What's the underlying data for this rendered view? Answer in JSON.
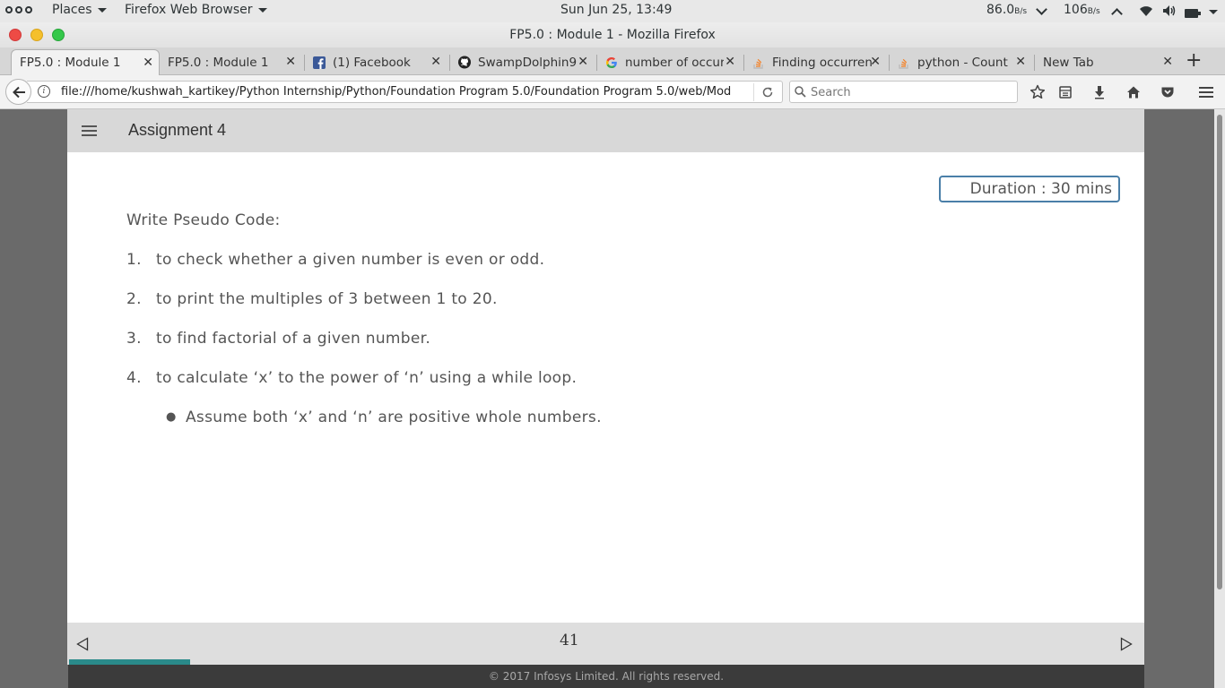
{
  "topbar": {
    "places": "Places",
    "app_menu": "Firefox Web Browser",
    "clock": "Sun Jun 25, 13:49",
    "net_down": "86.0",
    "net_down_unit": "B/s",
    "net_up": "106",
    "net_up_unit": "B/s"
  },
  "window": {
    "title": "FP5.0 : Module 1 - Mozilla Firefox"
  },
  "tabs": [
    {
      "label": "FP5.0 : Module 1",
      "icon": "none"
    },
    {
      "label": "FP5.0 : Module 1",
      "icon": "none"
    },
    {
      "label": "(1) Facebook",
      "icon": "facebook-icon"
    },
    {
      "label": "SwampDolphin9",
      "icon": "github-icon"
    },
    {
      "label": "number of occur",
      "icon": "google-icon"
    },
    {
      "label": "Finding occurren",
      "icon": "stackoverflow-icon"
    },
    {
      "label": "python - Count",
      "icon": "stackoverflow-icon"
    },
    {
      "label": "New Tab",
      "icon": "none"
    }
  ],
  "nav": {
    "url": "file:///home/kushwah_kartikey/Python Internship/Python/Foundation Program 5.0/Foundation Program 5.0/web/Mod",
    "search_placeholder": "Search"
  },
  "page": {
    "header_title": "Assignment 4",
    "duration": "Duration : 30 mins",
    "lead": "Write Pseudo Code:",
    "items": [
      {
        "num": "1.",
        "text": "to check whether a given number is even or odd."
      },
      {
        "num": "2.",
        "text": "to print the multiples of 3 between 1 to 20."
      },
      {
        "num": "3.",
        "text": "to find factorial of a given number."
      },
      {
        "num": "4.",
        "text": "to calculate ‘x’ to the power of ‘n’ using a while loop."
      }
    ],
    "sub_bullet": "Assume both ‘x’ and ‘n’ are positive whole numbers.",
    "page_number": "41",
    "progress_fraction": 0.113,
    "copyright": "© 2017 Infosys Limited. All rights reserved."
  },
  "colors": {
    "accent": "#2a8a8a",
    "duration_border": "#4a7fa8"
  }
}
